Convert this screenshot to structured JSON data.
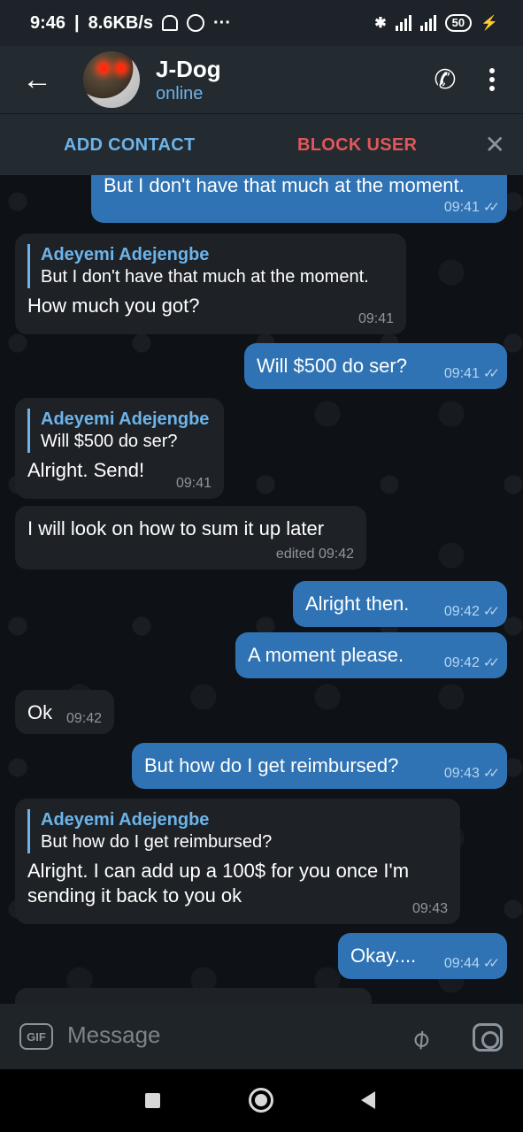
{
  "status_bar": {
    "time": "9:46",
    "speed": "8.6KB/s",
    "dots": "···",
    "battery": "50"
  },
  "header": {
    "title": "J-Dog",
    "subtitle": "online",
    "back_icon": "arrow-left-icon",
    "call_icon": "phone-icon",
    "menu_icon": "more-vertical-icon"
  },
  "actions": {
    "add_contact": "ADD CONTACT",
    "block_user": "BLOCK USER",
    "close": "✕"
  },
  "messages": [
    {
      "dir": "out",
      "text": "But I don't have that much at the moment.",
      "time": "09:41",
      "checks": "✓✓"
    },
    {
      "dir": "in",
      "reply_name": "Adeyemi Adejengbe",
      "reply_text": "But I don't have that much at the moment.",
      "text": "How much you got?",
      "time": "09:41"
    },
    {
      "dir": "out",
      "text": "Will $500 do ser?",
      "time": "09:41",
      "checks": "✓✓"
    },
    {
      "dir": "in",
      "reply_name": "Adeyemi Adejengbe",
      "reply_text": "Will $500 do ser?",
      "text": "Alright. Send!",
      "time": "09:41"
    },
    {
      "dir": "in",
      "text": "I will look on how to sum it up later",
      "time": "edited 09:42"
    },
    {
      "dir": "out",
      "text": "Alright then.",
      "time": "09:42",
      "checks": "✓✓"
    },
    {
      "dir": "out",
      "text": "A moment please.",
      "time": "09:42",
      "checks": "✓✓"
    },
    {
      "dir": "in",
      "text": "Ok",
      "time": "09:42"
    },
    {
      "dir": "out",
      "text": "But how do I get reimbursed?",
      "time": "09:43",
      "checks": "✓✓"
    },
    {
      "dir": "in",
      "reply_name": "Adeyemi Adejengbe",
      "reply_text": "But how do I get reimbursed?",
      "text": "Alright. I can add up a 100$ for you once I'm\nsending it back to you ok",
      "time": "09:43"
    },
    {
      "dir": "out",
      "text": "Okay....",
      "time": "09:44",
      "checks": "✓✓"
    }
  ],
  "input": {
    "gif_label": "GIF",
    "placeholder": "Message",
    "attach_icon": "paperclip-icon",
    "camera_icon": "camera-icon"
  }
}
